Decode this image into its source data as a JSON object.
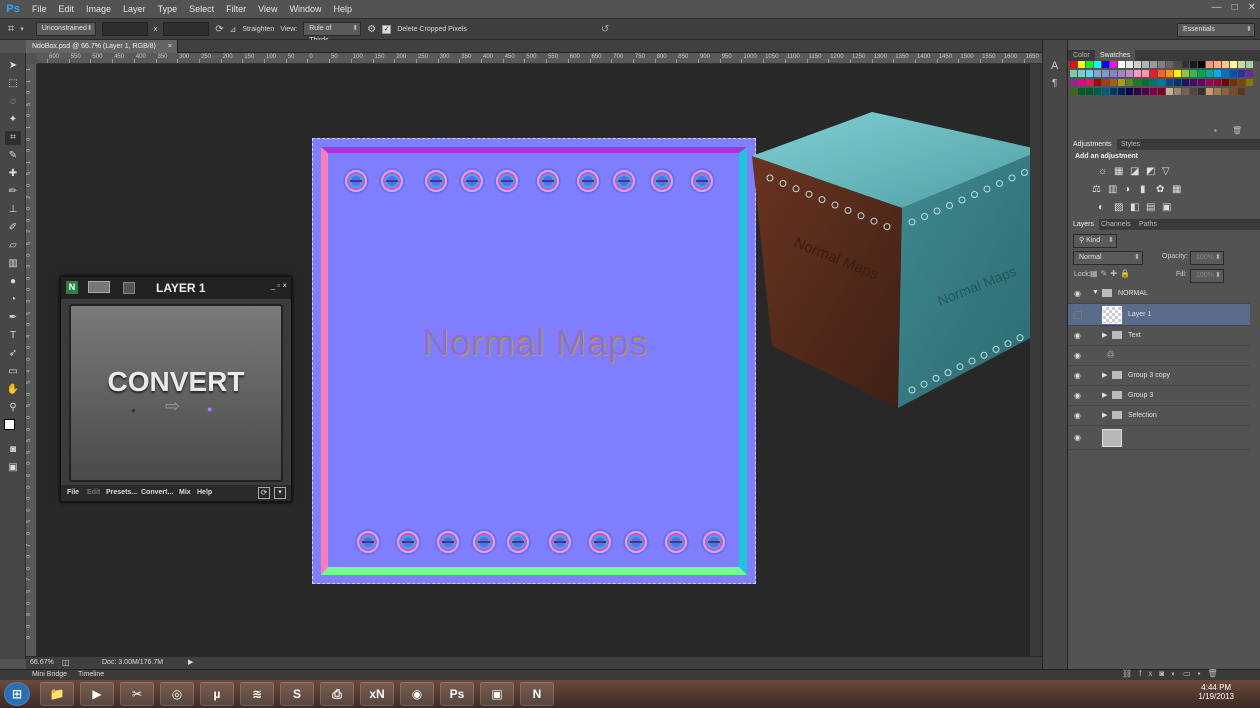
{
  "menubar": {
    "logo": "Ps",
    "items": [
      "File",
      "Edit",
      "Image",
      "Layer",
      "Type",
      "Select",
      "Filter",
      "View",
      "Window",
      "Help"
    ],
    "window_controls": [
      "—",
      "□",
      "✕"
    ]
  },
  "options": {
    "ratio": "Unconstrained",
    "x_sep": "x",
    "straighten": "Straighten",
    "view_label": "View:",
    "view_value": "Rule of Thirds",
    "delete_cropped": "Delete Cropped Pixels",
    "workspace": "Essentials"
  },
  "document": {
    "tab_title": "NdoBox.psd @ 66.7% (Layer 1, RGB/8)",
    "tab_close": "×",
    "canvas_text": "Normal Maps"
  },
  "ruler_top": [
    "600",
    "550",
    "500",
    "450",
    "400",
    "350",
    "300",
    "250",
    "200",
    "150",
    "100",
    "50",
    "0",
    "50",
    "100",
    "150",
    "200",
    "250",
    "300",
    "350",
    "400",
    "450",
    "500",
    "550",
    "600",
    "650",
    "700",
    "750",
    "800",
    "850",
    "900",
    "950",
    "1000",
    "1050",
    "1100",
    "1150",
    "1200",
    "1250",
    "1300",
    "1350",
    "1400",
    "1450",
    "1500",
    "1550",
    "1600",
    "1650"
  ],
  "ruler_left": [
    "1",
    "1",
    "0",
    "5",
    "0",
    "1",
    "0",
    "0",
    "1",
    "5",
    "0",
    "2",
    "0",
    "0",
    "2",
    "5",
    "0",
    "3",
    "0",
    "0",
    "3",
    "5",
    "0",
    "4",
    "0",
    "0",
    "4",
    "5",
    "0",
    "5",
    "0",
    "0",
    "5",
    "5",
    "0",
    "6",
    "0",
    "0",
    "6",
    "5",
    "0",
    "7",
    "0",
    "0",
    "7",
    "5",
    "0",
    "8",
    "0",
    "0"
  ],
  "status": {
    "zoom": "66.67%",
    "doc": "Doc: 3.00M/176.7M"
  },
  "minibridge": {
    "tabs": [
      "Mini Bridge",
      "Timeline"
    ]
  },
  "converter": {
    "title": "LAYER 1",
    "label": "CONVERT",
    "menu": [
      "File",
      "Edit",
      "Presets...",
      "Convert...",
      "Mix",
      "Help"
    ]
  },
  "panels": {
    "color_tabs": [
      "Color",
      "Swatches"
    ],
    "adjust_tabs": [
      "Adjustments",
      "Styles"
    ],
    "add_adjustment": "Add an adjustment",
    "layers_tabs": [
      "Layers",
      "Channels",
      "Paths"
    ],
    "kind": "Kind",
    "blend_mode": "Normal",
    "opacity_label": "Opacity:",
    "opacity_value": "100%",
    "lock_label": "Lock:",
    "fill_label": "Fill:",
    "fill_value": "100%",
    "layers": [
      {
        "name": "NORMAL",
        "type": "group-open"
      },
      {
        "name": "Layer 1",
        "type": "layer-selected"
      },
      {
        "name": "Text",
        "type": "group"
      },
      {
        "name": "",
        "type": "smart"
      },
      {
        "name": "Group 3 copy",
        "type": "group"
      },
      {
        "name": "Group 3",
        "type": "group"
      },
      {
        "name": "Selection",
        "type": "group"
      },
      {
        "name": "",
        "type": "background"
      }
    ]
  },
  "taskbar": {
    "apps": [
      "⊞",
      "📁",
      "▶",
      "✂",
      "◎",
      "µ",
      "≋",
      "S",
      "⎙",
      "xN",
      "◉",
      "Ps",
      "▣",
      "N"
    ],
    "time": "4:44 PM",
    "date": "1/19/2013"
  },
  "colors": {
    "normal_base": "#8080ff",
    "cube_side": "#4a8f94",
    "cube_left": "#5a2e1e",
    "accent_blue": "#2fa3f5"
  }
}
